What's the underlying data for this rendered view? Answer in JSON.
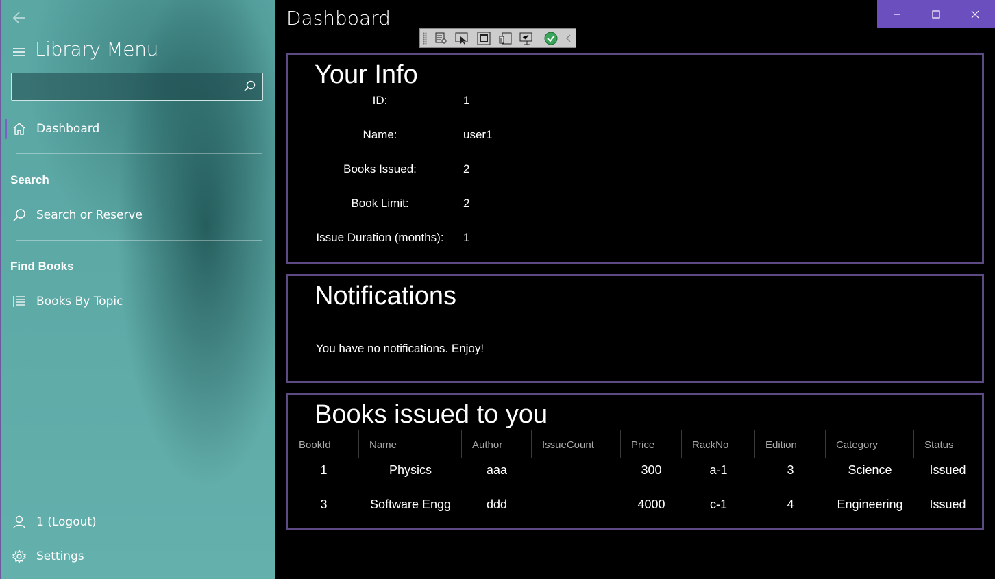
{
  "sidebar": {
    "title": "Library Menu",
    "search_placeholder": "",
    "items": [
      {
        "label": "Dashboard",
        "icon": "home-icon"
      },
      {
        "label": "Search or Reserve",
        "icon": "search-icon"
      },
      {
        "label": "Books By Topic",
        "icon": "list-icon"
      }
    ],
    "headers": [
      "Search",
      "Find Books"
    ],
    "footer": [
      {
        "label": "1 (Logout)",
        "icon": "person-icon"
      },
      {
        "label": "Settings",
        "icon": "gear-icon"
      }
    ]
  },
  "header": {
    "title": "Dashboard"
  },
  "your_info": {
    "title": "Your Info",
    "rows": [
      {
        "key": "ID:",
        "value": "1"
      },
      {
        "key": "Name:",
        "value": "user1"
      },
      {
        "key": "Books Issued:",
        "value": "2"
      },
      {
        "key": "Book Limit:",
        "value": "2"
      },
      {
        "key": "Issue Duration (months):",
        "value": "1"
      }
    ]
  },
  "notifications": {
    "title": "Notifications",
    "message": "You have no notifications. Enjoy!"
  },
  "books": {
    "title": "Books issued to you",
    "columns": [
      "BookId",
      "Name",
      "Author",
      "IssueCount",
      "Price",
      "RackNo",
      "Edition",
      "Category",
      "Status"
    ],
    "rows": [
      [
        "1",
        "Physics",
        "aaa",
        "",
        "300",
        "a-1",
        "3",
        "Science",
        "Issued"
      ],
      [
        "3",
        "Software Engg",
        "ddd",
        "",
        "4000",
        "c-1",
        "4",
        "Engineering",
        "Issued"
      ]
    ]
  },
  "colors": {
    "accent": "#6b4fbf",
    "panel_border": "#5d4a83",
    "sidebar_bg": "#5da9a6"
  }
}
